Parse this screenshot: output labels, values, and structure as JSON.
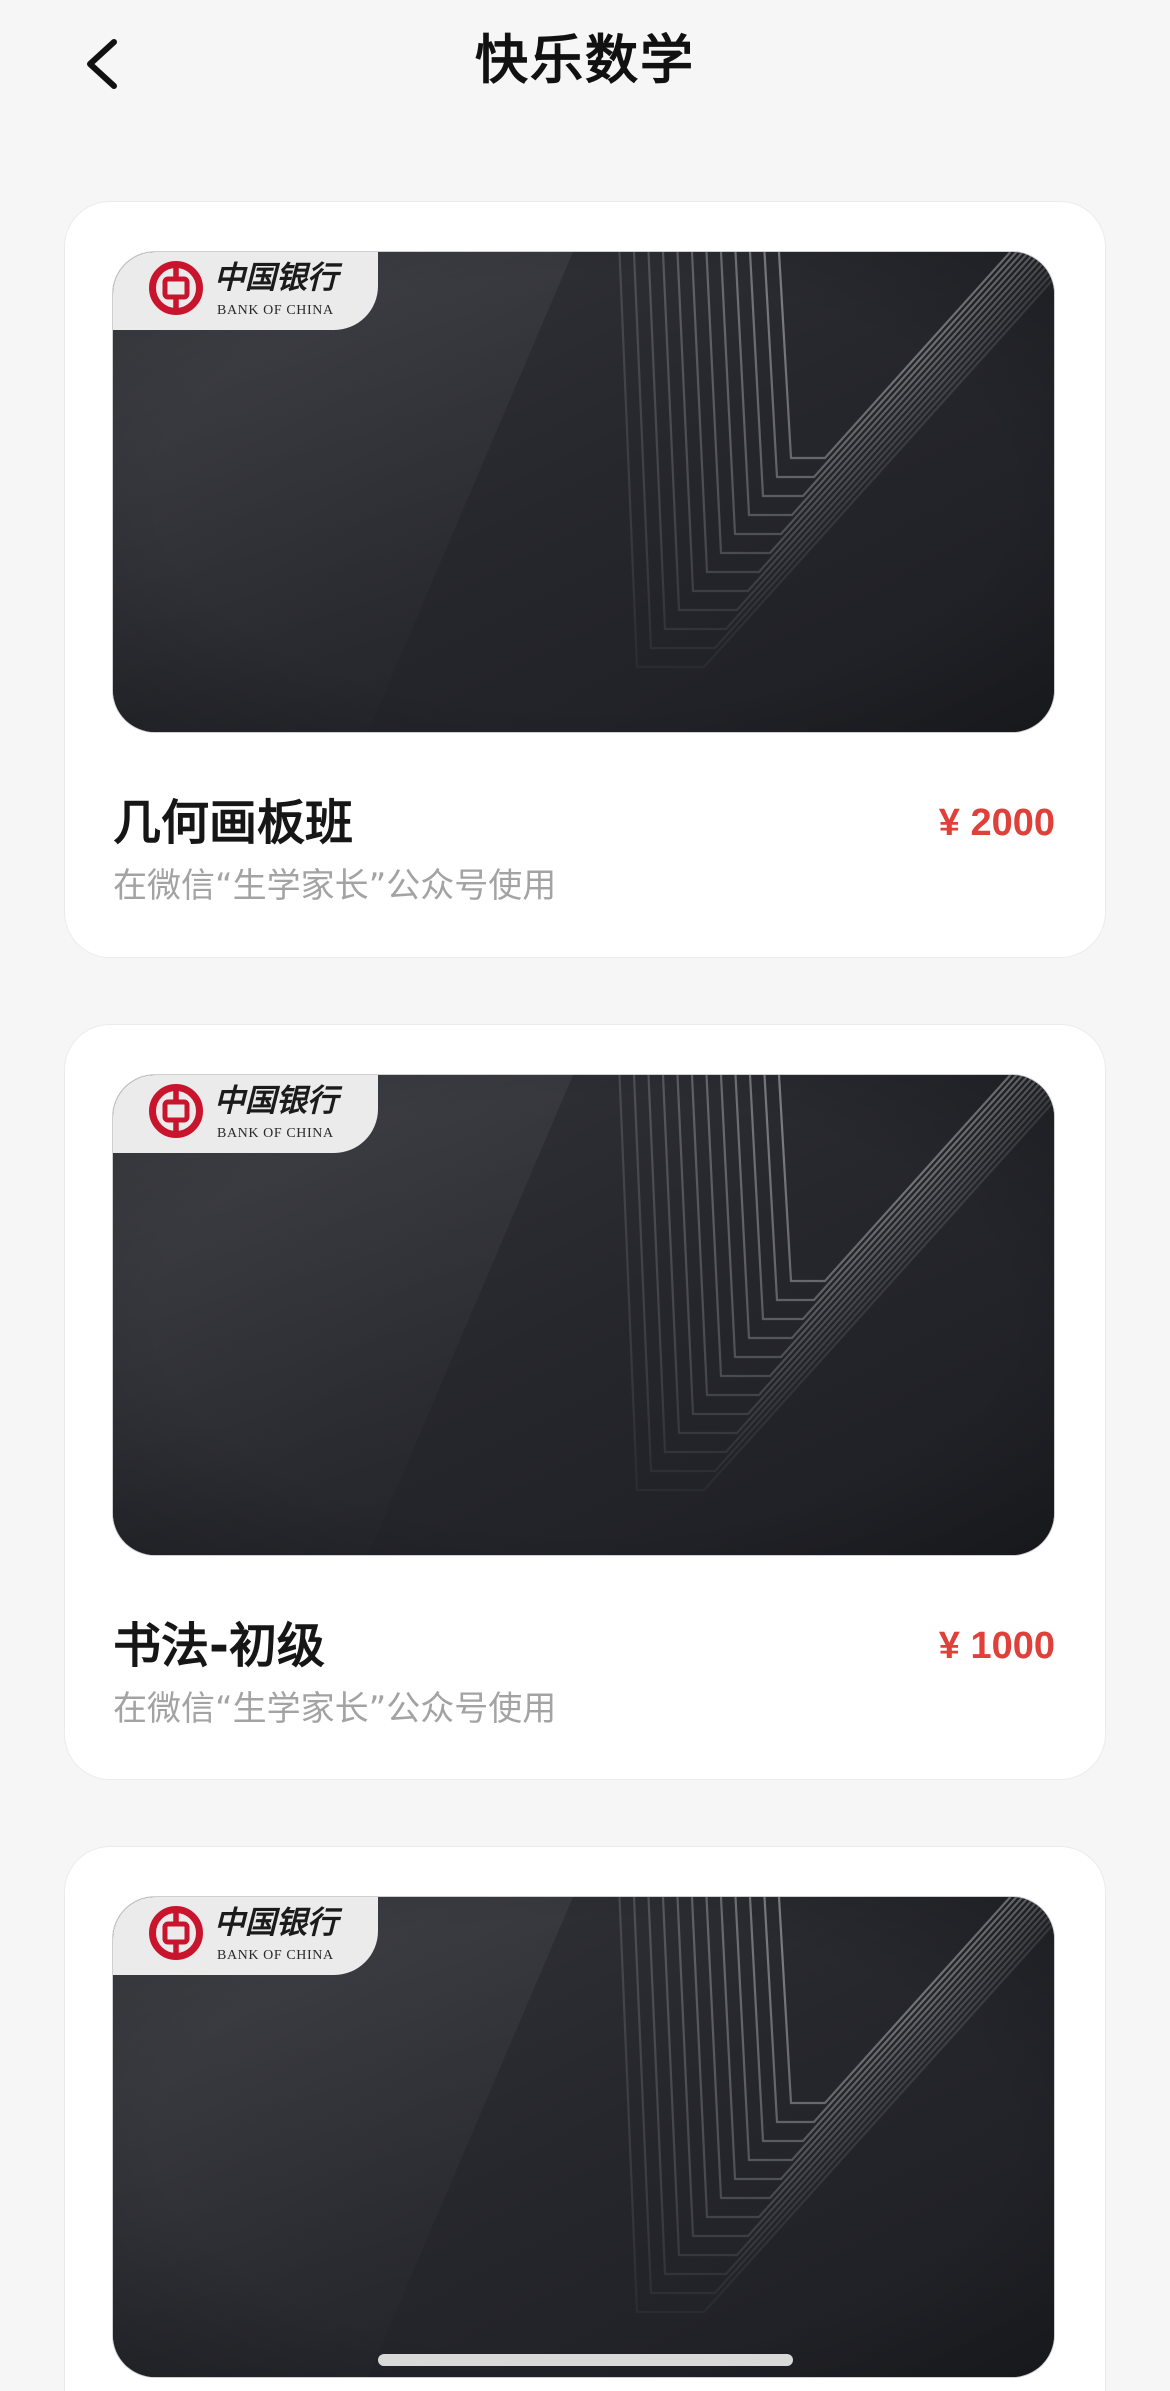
{
  "header": {
    "title": "快乐数学",
    "back_icon": "chevron-left-icon"
  },
  "bank": {
    "name_cn": "中国银行",
    "name_en": "BANK OF CHINA",
    "logo_icon": "bank-of-china-logo-icon"
  },
  "cards": [
    {
      "title": "几何画板班",
      "price": "¥ 2000",
      "subtitle": "在微信“生学家长”公众号使用"
    },
    {
      "title": "书法-初级",
      "price": "¥ 1000",
      "subtitle": "在微信“生学家长”公众号使用"
    }
  ],
  "colors": {
    "page_background": "#f6f6f6",
    "card_background": "#ffffff",
    "price": "#e0403a",
    "subtitle": "#a3a3a3",
    "bank_red": "#c8152d",
    "card_art_dark": "#23242a"
  }
}
